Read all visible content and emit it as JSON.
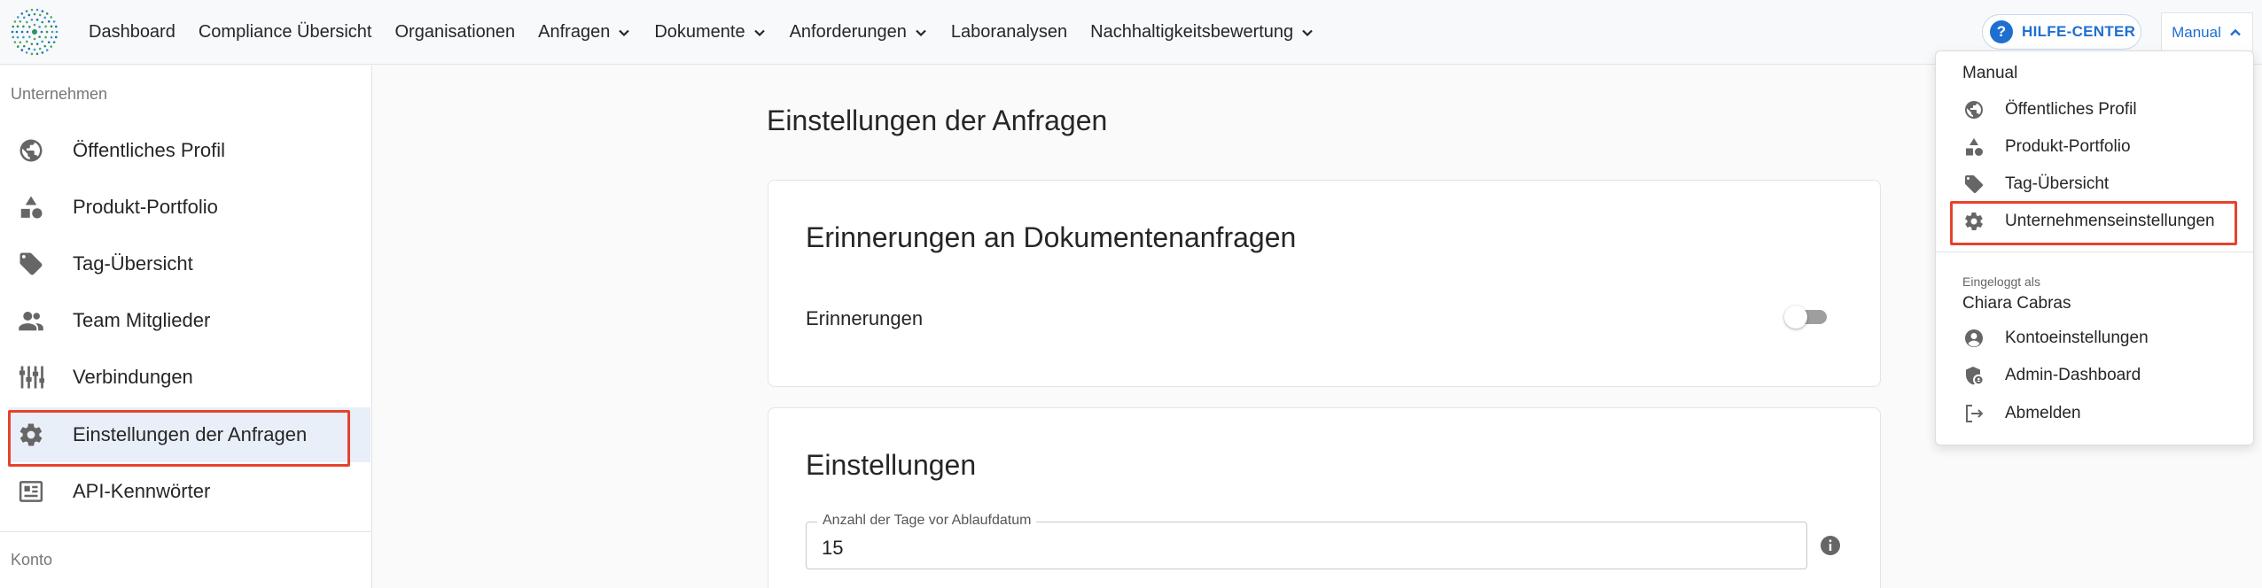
{
  "nav": {
    "items": [
      {
        "label": "Dashboard",
        "dropdown": false
      },
      {
        "label": "Compliance Übersicht",
        "dropdown": false
      },
      {
        "label": "Organisationen",
        "dropdown": false
      },
      {
        "label": "Anfragen",
        "dropdown": true
      },
      {
        "label": "Dokumente",
        "dropdown": true
      },
      {
        "label": "Anforderungen",
        "dropdown": true
      },
      {
        "label": "Laboranalysen",
        "dropdown": false
      },
      {
        "label": "Nachhaltigkeitsbewertung",
        "dropdown": true
      }
    ],
    "help_label": "HILFE-CENTER",
    "user_button": "Manual"
  },
  "sidebar": {
    "section_company": "Unternehmen",
    "items": [
      {
        "label": "Öffentliches Profil",
        "icon": "globe-icon"
      },
      {
        "label": "Produkt-Portfolio",
        "icon": "shapes-icon"
      },
      {
        "label": "Tag-Übersicht",
        "icon": "tag-icon"
      },
      {
        "label": "Team Mitglieder",
        "icon": "people-icon"
      },
      {
        "label": "Verbindungen",
        "icon": "sliders-icon"
      },
      {
        "label": "Einstellungen der Anfragen",
        "icon": "gear-icon"
      },
      {
        "label": "API-Kennwörter",
        "icon": "api-key-icon"
      }
    ],
    "section_account": "Konto"
  },
  "main": {
    "title": "Einstellungen der Anfragen",
    "reminders_card": {
      "title": "Erinnerungen an Dokumentenanfragen",
      "toggle_label": "Erinnerungen",
      "toggle_on": false
    },
    "settings_card": {
      "title": "Einstellungen",
      "field_label": "Anzahl der Tage vor Ablaufdatum",
      "field_value": "15"
    }
  },
  "menu": {
    "heading": "Manual",
    "items": [
      {
        "label": "Öffentliches Profil",
        "icon": "globe-icon"
      },
      {
        "label": "Produkt-Portfolio",
        "icon": "shapes-icon"
      },
      {
        "label": "Tag-Übersicht",
        "icon": "tag-icon"
      },
      {
        "label": "Unternehmenseinstellungen",
        "icon": "gear-icon"
      }
    ],
    "logged_in_label": "Eingeloggt als",
    "user_name": "Chiara Cabras",
    "account_items": [
      {
        "label": "Kontoeinstellungen",
        "icon": "account-circle-icon"
      },
      {
        "label": "Admin-Dashboard",
        "icon": "admin-shield-icon"
      },
      {
        "label": "Abmelden",
        "icon": "logout-icon"
      }
    ]
  },
  "colors": {
    "accent": "#1f6fd1",
    "highlight": "#e8412e",
    "active_bg": "#e9eff8"
  }
}
